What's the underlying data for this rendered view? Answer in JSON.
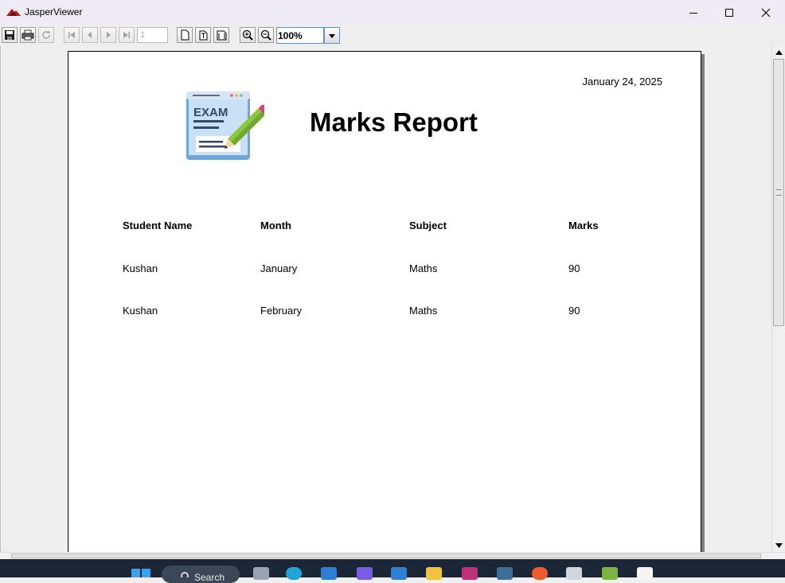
{
  "window": {
    "title": "JasperViewer",
    "controls": {
      "minimize_icon": "minimize-icon",
      "maximize_icon": "maximize-icon",
      "close_icon": "close-icon"
    }
  },
  "toolbar": {
    "page_number_value": "1",
    "zoom_value": "100%",
    "buttons": [
      "save-icon",
      "print-icon",
      "reload-icon",
      "first-page-icon",
      "previous-page-icon",
      "next-page-icon",
      "last-page-icon",
      "actual-size-icon",
      "fit-page-icon",
      "fit-width-icon",
      "zoom-in-icon",
      "zoom-out-icon",
      "dropdown-arrow-icon"
    ]
  },
  "report": {
    "date": "January 24, 2025",
    "title": "Marks Report",
    "logo_text": "EXAM",
    "columns": [
      "Student Name",
      "Month",
      "Subject",
      "Marks"
    ],
    "rows": [
      {
        "student": "Kushan",
        "month": "January",
        "subject": "Maths",
        "marks": "90"
      },
      {
        "student": "Kushan",
        "month": "February",
        "subject": "Maths",
        "marks": "90"
      }
    ]
  },
  "taskbar": {
    "search_label": "Search"
  },
  "colors": {
    "titlebar": "#eeebf5",
    "taskbar": "#1b2736",
    "logo_blue": "#6ea6d8",
    "pencil_green": "#8dc63f",
    "page_shadow": "#7f7f7f"
  }
}
